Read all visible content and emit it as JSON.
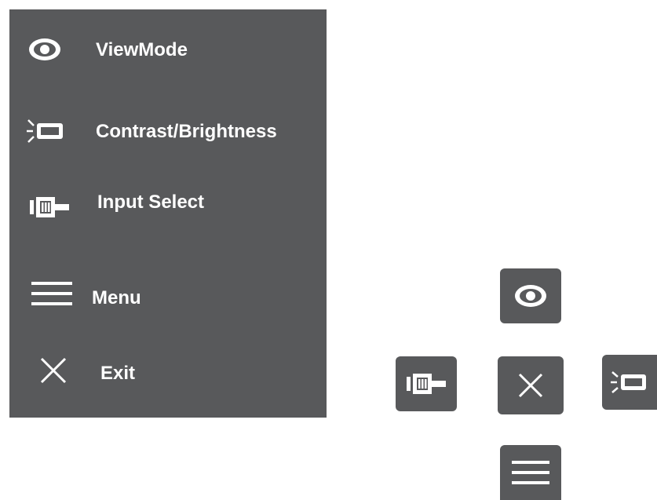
{
  "osd_menu": {
    "items": [
      {
        "label": "ViewMode",
        "icon": "eye-icon"
      },
      {
        "label": "Contrast/Brightness",
        "icon": "brightness-icon"
      },
      {
        "label": "Input Select",
        "icon": "input-source-icon"
      },
      {
        "label": "Menu",
        "icon": "menu-lines-icon"
      },
      {
        "label": "Exit",
        "icon": "close-icon"
      }
    ]
  },
  "hotkeys": [
    {
      "position": "up",
      "icon": "eye-icon"
    },
    {
      "position": "left",
      "icon": "input-source-icon"
    },
    {
      "position": "center",
      "icon": "close-icon"
    },
    {
      "position": "right",
      "icon": "brightness-icon"
    },
    {
      "position": "down",
      "icon": "menu-lines-icon"
    }
  ],
  "colors": {
    "panel": "#58595b",
    "foreground": "#ffffff",
    "background": "#ffffff"
  }
}
